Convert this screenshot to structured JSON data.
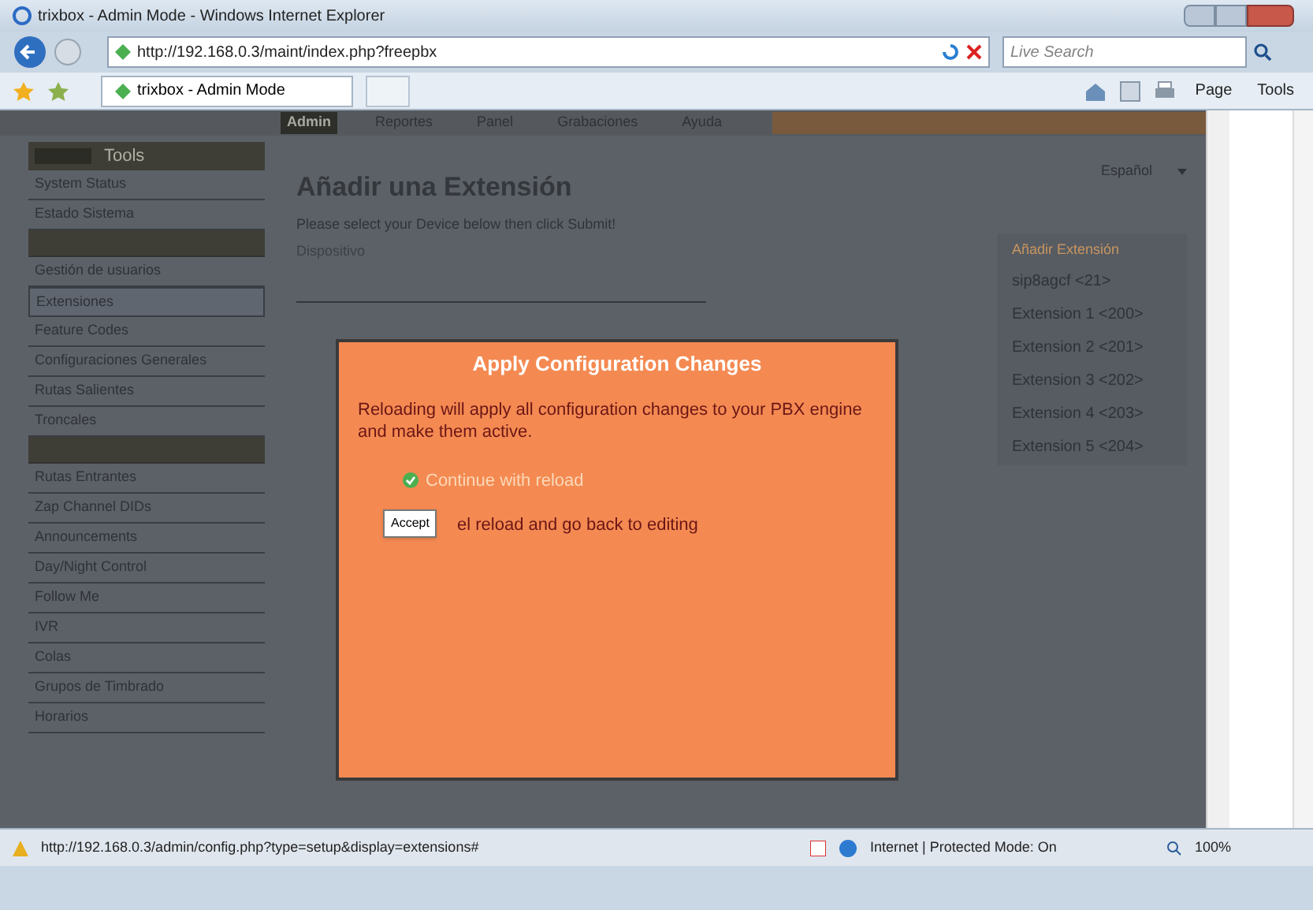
{
  "window": {
    "title": "trixbox - Admin Mode - Windows Internet Explorer"
  },
  "address_bar": {
    "url": "http://192.168.0.3/maint/index.php?freepbx"
  },
  "search": {
    "placeholder": "Live Search"
  },
  "tab": {
    "label": "trixbox - Admin Mode"
  },
  "toolbar": [
    "Page",
    "Tools"
  ],
  "nav_tabs": [
    {
      "label": "Admin",
      "selected": true
    },
    {
      "label": "Reportes",
      "selected": false
    },
    {
      "label": "Panel",
      "selected": false
    },
    {
      "label": "Grabaciones",
      "selected": false
    },
    {
      "label": "Ayuda",
      "selected": false
    }
  ],
  "sidebar": {
    "title": "Tools",
    "items": [
      {
        "label": "System Status",
        "kind": "item",
        "selected": false
      },
      {
        "label": "Estado Sistema",
        "kind": "item",
        "selected": false
      },
      {
        "kind": "header"
      },
      {
        "label": "Gestión de usuarios",
        "kind": "item",
        "selected": false
      },
      {
        "label": "Extensiones",
        "kind": "item",
        "selected": true
      },
      {
        "label": "Feature Codes",
        "kind": "item",
        "selected": false
      },
      {
        "label": "Configuraciones Generales",
        "kind": "item",
        "selected": false
      },
      {
        "label": "Rutas Salientes",
        "kind": "item",
        "selected": false
      },
      {
        "label": "Troncales",
        "kind": "item",
        "selected": false
      },
      {
        "kind": "header"
      },
      {
        "label": "Rutas Entrantes",
        "kind": "item",
        "selected": false
      },
      {
        "label": "Zap Channel DIDs",
        "kind": "item",
        "selected": false
      },
      {
        "label": "Announcements",
        "kind": "item",
        "selected": false
      },
      {
        "label": "Day/Night Control",
        "kind": "item",
        "selected": false
      },
      {
        "label": "Follow Me",
        "kind": "item",
        "selected": false
      },
      {
        "label": "IVR",
        "kind": "item",
        "selected": false
      },
      {
        "label": "Colas",
        "kind": "item",
        "selected": false
      },
      {
        "label": "Grupos de Timbrado",
        "kind": "item",
        "selected": false
      },
      {
        "label": "Horarios",
        "kind": "item",
        "selected": false
      }
    ]
  },
  "main": {
    "heading": "Añadir una Extensión",
    "instruction": "Please select your Device below then click Submit!",
    "field_label": "Dispositivo"
  },
  "language": {
    "value": "Español"
  },
  "extensions": {
    "title": "Añadir Extensión",
    "items": [
      "sip8agcf <21>",
      "Extension 1 <200>",
      "Extension 2 <201>",
      "Extension 3 <202>",
      "Extension 4 <203>",
      "Extension 5 <204>"
    ]
  },
  "dialog": {
    "title": "Apply Configuration Changes",
    "message": "Reloading will apply all configuration changes to your PBX engine and make them active.",
    "options": [
      {
        "label": "Continue with reload",
        "kind": "continue"
      },
      {
        "label": "el reload and go back to editing",
        "kind": "cancel"
      }
    ],
    "tooltip": "Accept"
  },
  "status_bar": {
    "url": "http://192.168.0.3/admin/config.php?type=setup&display=extensions#",
    "zone": "Internet | Protected Mode: On",
    "zoom": "100%"
  }
}
